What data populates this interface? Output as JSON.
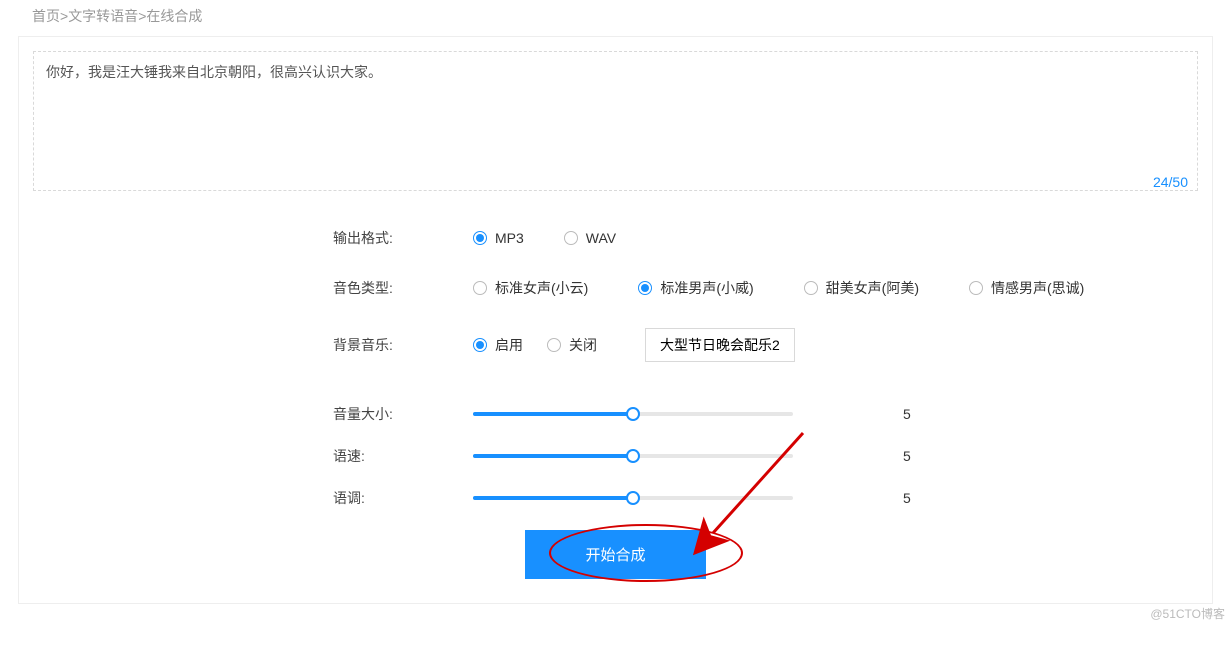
{
  "breadcrumb": {
    "home": "首页",
    "section": "文字转语音",
    "current": "在线合成"
  },
  "textarea": {
    "value": "你好，我是汪大锤我来自北京朝阳，很高兴认识大家。",
    "counter": "24/50"
  },
  "output_format": {
    "label": "输出格式:",
    "options": {
      "mp3": "MP3",
      "wav": "WAV"
    },
    "selected": "mp3"
  },
  "voice_type": {
    "label": "音色类型:",
    "options": {
      "female_std": "标准女声(小云)",
      "male_std": "标准男声(小威)",
      "female_sweet": "甜美女声(阿美)",
      "male_emotion": "情感男声(思诚)"
    },
    "selected": "male_std"
  },
  "bg_music": {
    "label": "背景音乐:",
    "options": {
      "on": "启用",
      "off": "关闭"
    },
    "selected": "on",
    "track_button": "大型节日晚会配乐2"
  },
  "volume": {
    "label": "音量大小:",
    "value": 5,
    "min": 0,
    "max": 10
  },
  "speed": {
    "label": "语速:",
    "value": 5,
    "min": 0,
    "max": 10
  },
  "pitch": {
    "label": "语调:",
    "value": 5,
    "min": 0,
    "max": 10
  },
  "submit_label": "开始合成",
  "watermark": "@51CTO博客"
}
